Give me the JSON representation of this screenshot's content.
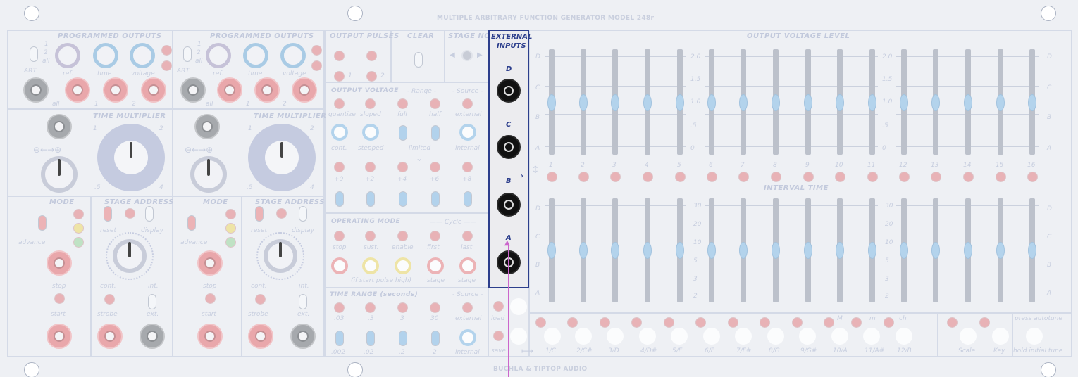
{
  "module": {
    "title": "MULTIPLE ARBITRARY FUNCTION GENERATOR MODEL 248r",
    "brand": "BUCHLA & TIPTOP AUDIO"
  },
  "programmed_outputs": {
    "header": "PROGRAMMED   OUTPUTS",
    "switch_labels": [
      "1",
      "2",
      "all"
    ],
    "start_label": "ART",
    "knob_labels": [
      "ref.",
      "time",
      "voltage"
    ],
    "jack_labels": [
      "all",
      "1",
      "2"
    ]
  },
  "time_multiplier": {
    "header": "TIME MULTIPLIER",
    "range_labels": [
      "1",
      "2",
      ".5",
      "4"
    ]
  },
  "mode": {
    "header": "MODE",
    "advance_label": "advance",
    "stop_label": "stop",
    "start_label": "start"
  },
  "stage_address": {
    "header": "STAGE ADDRESS",
    "labels": [
      "reset",
      "display",
      "cont.",
      "int.",
      "strobe",
      "ext."
    ]
  },
  "output_pulses": {
    "header": "OUTPUT  PULSES",
    "labels": [
      "1",
      "2"
    ]
  },
  "clear": {
    "header": "CLEAR"
  },
  "stage_no": {
    "header": "STAGE NO"
  },
  "output_voltage": {
    "header": "OUTPUT VOLTAGE",
    "range_header": "- Range -",
    "source_header": "- Source -",
    "row1": [
      "quantize",
      "sloped",
      "full",
      "half",
      "external"
    ],
    "row2": [
      "cont.",
      "stepped",
      "limited",
      "internal"
    ],
    "offsets": [
      "+0",
      "+2",
      "+4",
      "+6",
      "+8"
    ]
  },
  "operating_mode": {
    "header": "OPERATING MODE",
    "cycle_header": "—— Cycle ——",
    "row1": [
      "stop",
      "sust.",
      "enable",
      "first",
      "last"
    ],
    "note": "(if start pulse high)",
    "row2": [
      "stage",
      "stage"
    ]
  },
  "time_range": {
    "header": "TIME RANGE (seconds)",
    "source_header": "- Source -",
    "row1": [
      ".03",
      ".3",
      "3",
      "30",
      "external"
    ],
    "row2": [
      ".002",
      ".02",
      ".2",
      "2",
      "internal"
    ]
  },
  "external_inputs": {
    "header_line1": "EXTERNAL",
    "header_line2": "INPUTS",
    "inputs": [
      "D",
      "C",
      "B",
      "A"
    ]
  },
  "load_save": {
    "load": "load",
    "save": "save"
  },
  "output_voltage_level": {
    "header": "OUTPUT VOLTAGE LEVEL",
    "row_labels": [
      "D",
      "C",
      "B",
      "A"
    ],
    "scale": [
      "2.0",
      "1.5",
      "1.0",
      ".5",
      "0"
    ],
    "stage_numbers": [
      "1",
      "2",
      "3",
      "4",
      "5",
      "6",
      "7",
      "8",
      "9",
      "10",
      "11",
      "12",
      "13",
      "14",
      "15",
      "16"
    ]
  },
  "interval_time": {
    "header": "INTERVAL TIME",
    "scale": [
      "30",
      "20",
      "10",
      "5",
      "3",
      "2"
    ]
  },
  "keyboard": {
    "keys": [
      "1/C",
      "2/C#",
      "3/D",
      "4/D#",
      "5/E",
      "6/F",
      "7/F#",
      "8/G",
      "9/G#",
      "10/A",
      "11/A#",
      "12/B"
    ],
    "mode_labels": [
      "M",
      "m",
      "ch"
    ],
    "scale_label": "Scale",
    "key_label": "Key",
    "autotune_line1": "press autotune",
    "autotune_line2": "hold initial tune"
  },
  "colors": {
    "panel": "#eef0f4",
    "led_red": "#e8b2b6",
    "slider_cap": "#b3d3ec",
    "highlight_border": "#2c3e8c",
    "cable": "#cc66cc"
  }
}
